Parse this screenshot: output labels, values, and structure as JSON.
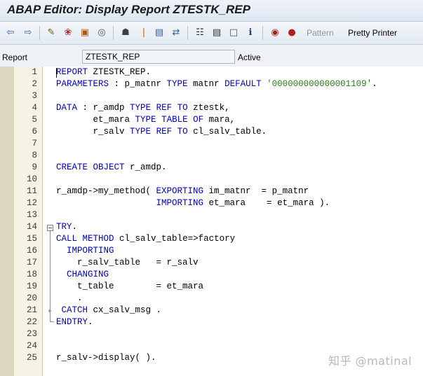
{
  "window": {
    "title": "ABAP Editor: Display Report ZTESTK_REP"
  },
  "toolbar": {
    "icons": [
      "back-arrow-icon",
      "forward-arrow-icon",
      "toggle-edit-icon",
      "activate-icon",
      "check-icon",
      "test-icon",
      "where-used-icon",
      "object-list-icon",
      "breakpoint-icon",
      "display-object-icon",
      "navigate-icon",
      "hierarchy-icon",
      "print-icon",
      "block-icon",
      "info-icon",
      "stop-icon",
      "find-icon"
    ],
    "pattern_label": "Pattern",
    "pretty_printer_label": "Pretty Printer"
  },
  "fieldbar": {
    "report_label": "Report",
    "report_value": "ZTESTK_REP",
    "status": "Active"
  },
  "code_lines": [
    {
      "n": "1",
      "t": "REPORT ZTESTK_REP."
    },
    {
      "n": "2",
      "t": "PARAMETERS : p_matnr TYPE matnr DEFAULT '000000000000001109'."
    },
    {
      "n": "3",
      "t": ""
    },
    {
      "n": "4",
      "t": "DATA : r_amdp TYPE REF TO ztestk,"
    },
    {
      "n": "5",
      "t": "       et_mara TYPE TABLE OF mara,"
    },
    {
      "n": "6",
      "t": "       r_salv TYPE REF TO cl_salv_table."
    },
    {
      "n": "7",
      "t": ""
    },
    {
      "n": "8",
      "t": ""
    },
    {
      "n": "9",
      "t": "CREATE OBJECT r_amdp."
    },
    {
      "n": "10",
      "t": ""
    },
    {
      "n": "11",
      "t": "r_amdp->my_method( EXPORTING im_matnr  = p_matnr"
    },
    {
      "n": "12",
      "t": "                   IMPORTING et_mara    = et_mara )."
    },
    {
      "n": "13",
      "t": ""
    },
    {
      "n": "14",
      "t": "TRY."
    },
    {
      "n": "15",
      "t": "CALL METHOD cl_salv_table=>factory"
    },
    {
      "n": "16",
      "t": "  IMPORTING"
    },
    {
      "n": "17",
      "t": "    r_salv_table   = r_salv"
    },
    {
      "n": "18",
      "t": "  CHANGING"
    },
    {
      "n": "19",
      "t": "    t_table        = et_mara"
    },
    {
      "n": "20",
      "t": "    ."
    },
    {
      "n": "21",
      "t": " CATCH cx_salv_msg ."
    },
    {
      "n": "22",
      "t": "ENDTRY."
    },
    {
      "n": "23",
      "t": ""
    },
    {
      "n": "24",
      "t": ""
    },
    {
      "n": "25",
      "t": "r_salv->display( )."
    }
  ],
  "watermark": "知乎 @matinal"
}
